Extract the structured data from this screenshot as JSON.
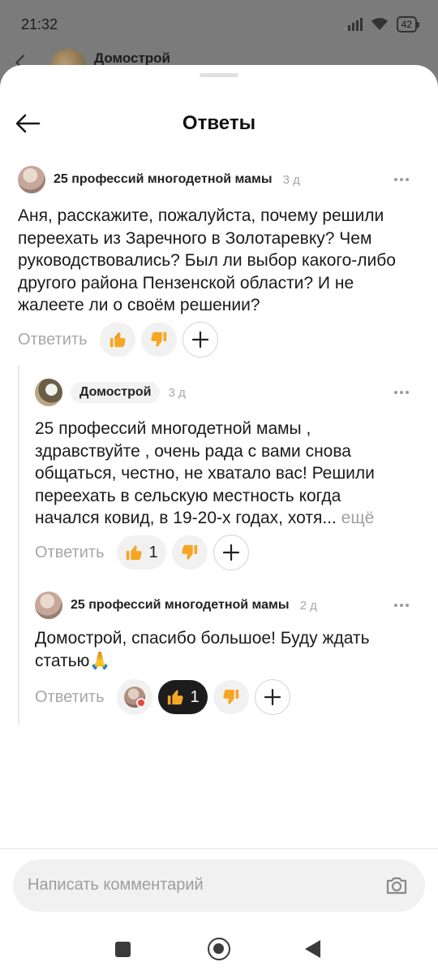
{
  "status_bar": {
    "time": "21:32",
    "battery": "42"
  },
  "background_page": {
    "title": "Домострой"
  },
  "sheet": {
    "title": "Ответы"
  },
  "comments": [
    {
      "author": "25 профессий многодетной мамы",
      "age": "3 д",
      "text": "Аня, расскажите, пожалуйста, почему решили переехать из Заречного в Золотаревку? Чем руководствовались? Был ли выбор какого-либо другого района Пензенской области? И не жалеете ли о своём решении?",
      "reply_label": "Ответить",
      "like_count": "",
      "like_icon": "thumbs-up-icon",
      "dislike_icon": "thumbs-down-icon"
    },
    {
      "author": "Домострой",
      "age": "3 д",
      "text": "25 профессий многодетной мамы , здравствуйте , очень рада с вами снова общаться, честно, не хватало вас! Решили переехать в сельскую местность когда начался ковид, в 19-20-х годах, хотя...",
      "more_label": "ещё",
      "reply_label": "Ответить",
      "like_count": "1"
    },
    {
      "author": "25 профессий многодетной мамы",
      "age": "2 д",
      "text": "Домострой, спасибо большое! Буду ждать статью",
      "emoji": "🙏",
      "reply_label": "Ответить",
      "like_count": "1"
    }
  ],
  "composer": {
    "placeholder": "Написать комментарий"
  },
  "colors": {
    "accent_dark": "#1c1c1c",
    "pill_bg": "#f1f1f1",
    "muted_text": "#a7a7a7"
  }
}
